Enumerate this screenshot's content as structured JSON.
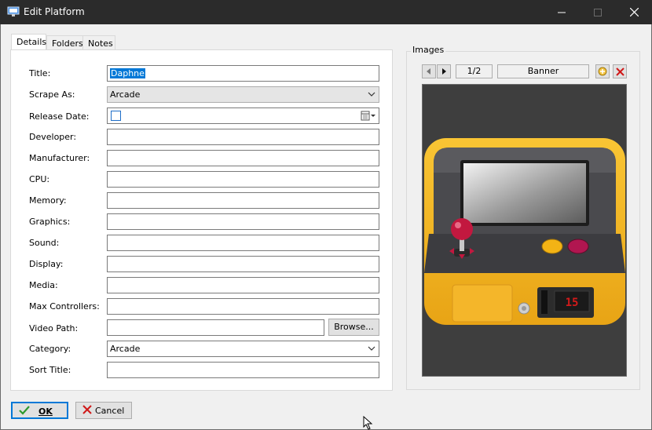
{
  "window": {
    "title": "Edit Platform"
  },
  "tabs": [
    "Details",
    "Folders",
    "Notes"
  ],
  "fields": {
    "title": {
      "label": "Title:",
      "value": "Daphne"
    },
    "scrape_as": {
      "label": "Scrape As:",
      "value": "Arcade"
    },
    "release_date": {
      "label": "Release Date:",
      "value": ""
    },
    "developer": {
      "label": "Developer:",
      "value": ""
    },
    "manufacturer": {
      "label": "Manufacturer:",
      "value": ""
    },
    "cpu": {
      "label": "CPU:",
      "value": ""
    },
    "memory": {
      "label": "Memory:",
      "value": ""
    },
    "graphics": {
      "label": "Graphics:",
      "value": ""
    },
    "sound": {
      "label": "Sound:",
      "value": ""
    },
    "display": {
      "label": "Display:",
      "value": ""
    },
    "media": {
      "label": "Media:",
      "value": ""
    },
    "max_controllers": {
      "label": "Max Controllers:",
      "value": ""
    },
    "video_path": {
      "label": "Video Path:",
      "value": "",
      "browse_label": "Browse..."
    },
    "category": {
      "label": "Category:",
      "value": "Arcade"
    },
    "sort_title": {
      "label": "Sort Title:",
      "value": ""
    }
  },
  "images": {
    "group_title": "Images",
    "counter": "1/2",
    "type": "Banner",
    "screen_text": "15"
  },
  "footer": {
    "ok_label": "OK",
    "cancel_label": "Cancel"
  },
  "colors": {
    "titlebar": "#2b2b2b",
    "accent": "#0078d7",
    "arcade_yellow": "#f5b51f",
    "joystick_red": "#c2183f"
  }
}
